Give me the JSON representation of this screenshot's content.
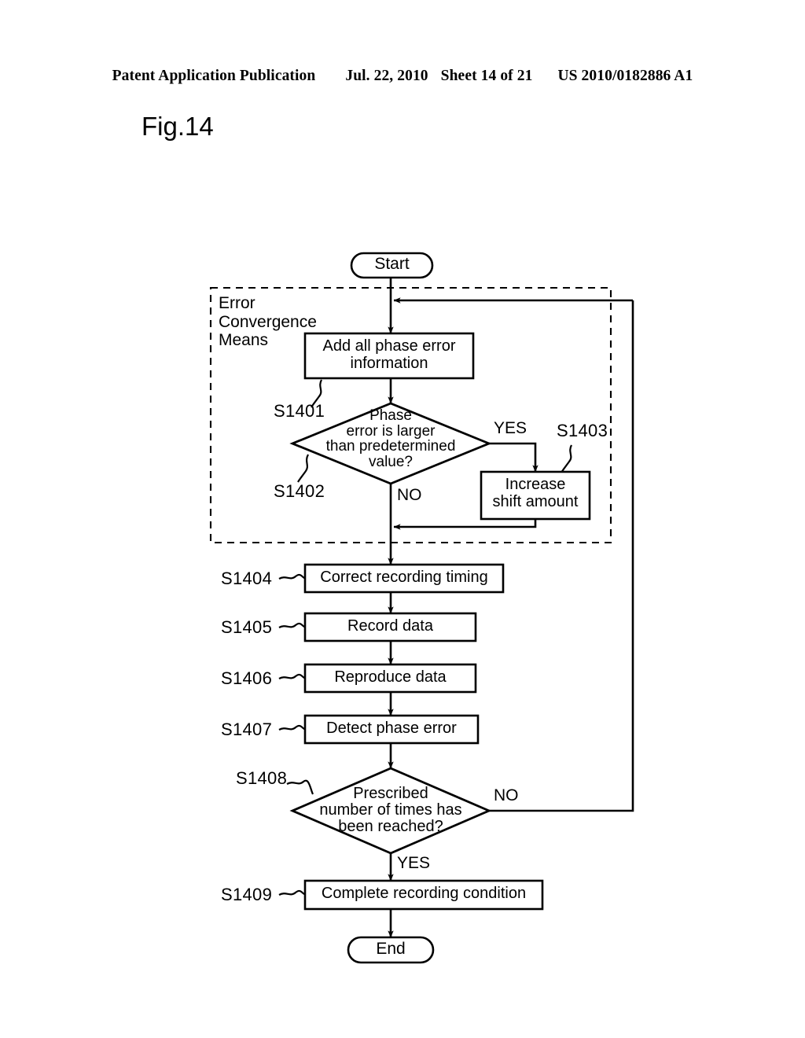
{
  "header": {
    "publication": "Patent Application Publication",
    "date": "Jul. 22, 2010",
    "sheet": "Sheet 14 of 21",
    "docnumber": "US 2010/0182886 A1"
  },
  "figure": {
    "label": "Fig.14"
  },
  "diagram": {
    "group_label": "Error\nConvergence\nMeans",
    "nodes": {
      "start": "Start",
      "add_error": "Add all phase error\ninformation",
      "decision_phase": "Phase\nerror is larger\nthan predetermined\nvalue?",
      "increase_shift": "Increase\nshift amount",
      "correct_timing": "Correct recording timing",
      "record_data": "Record data",
      "reproduce_data": "Reproduce data",
      "detect_error": "Detect phase error",
      "decision_count": "Prescribed\nnumber of times has\nbeen reached?",
      "complete_condition": "Complete recording condition",
      "end": "End"
    },
    "step_labels": {
      "s1401": "S1401",
      "s1402": "S1402",
      "s1403": "S1403",
      "s1404": "S1404",
      "s1405": "S1405",
      "s1406": "S1406",
      "s1407": "S1407",
      "s1408": "S1408",
      "s1409": "S1409"
    },
    "branch_labels": {
      "phase_yes": "YES",
      "phase_no": "NO",
      "count_no": "NO",
      "count_yes": "YES"
    },
    "colors": {
      "ink": "#000000",
      "paper": "#ffffff"
    }
  }
}
